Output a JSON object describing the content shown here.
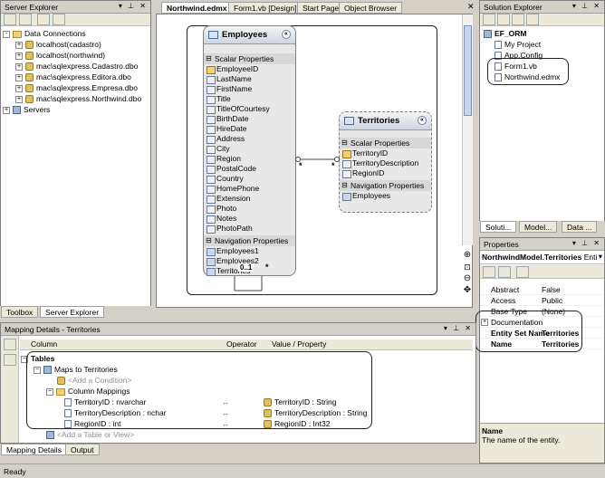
{
  "server_explorer": {
    "title": "Server Explorer",
    "tree": [
      {
        "label": "Data Connections",
        "level": 0,
        "type": "folder",
        "exp": "-"
      },
      {
        "label": "localhost(cadastro)",
        "level": 1,
        "type": "db",
        "exp": "+"
      },
      {
        "label": "localhost(northwind)",
        "level": 1,
        "type": "db",
        "exp": "+"
      },
      {
        "label": "mac\\sqlexpress.Cadastro.dbo",
        "level": 1,
        "type": "db",
        "exp": "+"
      },
      {
        "label": "mac\\sqlexpress.Editora.dbo",
        "level": 1,
        "type": "db",
        "exp": "+"
      },
      {
        "label": "mac\\sqlexpress.Empresa.dbo",
        "level": 1,
        "type": "db",
        "exp": "+"
      },
      {
        "label": "mac\\sqlexpress.Northwind.dbo",
        "level": 1,
        "type": "db",
        "exp": "+"
      },
      {
        "label": "Servers",
        "level": 0,
        "type": "server",
        "exp": "+"
      }
    ],
    "bottom_tabs": [
      "Toolbox",
      "Server Explorer"
    ]
  },
  "doc_tabs": [
    "Northwind.edmx",
    "Form1.vb [Design]",
    "Start Page",
    "Object Browser"
  ],
  "designer": {
    "employees": {
      "title": "Employees",
      "scalar_header": "Scalar Properties",
      "scalar": [
        "EmployeeID",
        "LastName",
        "FirstName",
        "Title",
        "TitleOfCourtesy",
        "BirthDate",
        "HireDate",
        "Address",
        "City",
        "Region",
        "PostalCode",
        "Country",
        "HomePhone",
        "Extension",
        "Photo",
        "Notes",
        "PhotoPath"
      ],
      "nav_header": "Navigation Properties",
      "nav": [
        "Employees1",
        "Employees2",
        "Territories"
      ]
    },
    "territories": {
      "title": "Territories",
      "scalar_header": "Scalar Properties",
      "scalar": [
        "TerritoryID",
        "TerritoryDescription",
        "RegionID"
      ],
      "nav_header": "Navigation Properties",
      "nav": [
        "Employees"
      ]
    },
    "self_assoc_label": "0..1",
    "assoc_mult_left": "*",
    "assoc_mult_right": "*",
    "self_assoc_mult": "*"
  },
  "solution_explorer": {
    "title": "Solution Explorer",
    "tree": [
      {
        "label": "EF_ORM",
        "level": 0,
        "bold": true
      },
      {
        "label": "My Project",
        "level": 1
      },
      {
        "label": "App.Config",
        "level": 1
      },
      {
        "label": "Form1.vb",
        "level": 1
      },
      {
        "label": "Northwind.edmx",
        "level": 1
      }
    ],
    "bottom_tabs": [
      "Soluti...",
      "Model...",
      "Data ..."
    ]
  },
  "properties": {
    "title": "Properties",
    "object": "NorthwindModel.Territories",
    "object_type": "Enti",
    "rows": [
      {
        "key": "Abstract",
        "value": "False",
        "bold": false
      },
      {
        "key": "Access",
        "value": "Public",
        "bold": false
      },
      {
        "key": "Base Type",
        "value": "(None)",
        "bold": false
      },
      {
        "key": "Documentation",
        "value": "",
        "bold": false,
        "expander": "+"
      },
      {
        "key": "Entity Set Name",
        "value": "Territories",
        "bold": true
      },
      {
        "key": "Name",
        "value": "Territories",
        "bold": true
      }
    ],
    "desc_title": "Name",
    "desc_text": "The name of the entity."
  },
  "mapping": {
    "title": "Mapping Details - Territories",
    "columns": [
      "Column",
      "Operator",
      "Value / Property"
    ],
    "tables_label": "Tables",
    "maps_to": "Maps to Territories",
    "add_condition": "<Add a Condition>",
    "column_mappings": "Column Mappings",
    "rows": [
      {
        "column": "TerritoryID : nvarchar",
        "op": "↔",
        "value": "TerritoryID : String"
      },
      {
        "column": "TerritoryDescription : nchar",
        "op": "↔",
        "value": "TerritoryDescription : String"
      },
      {
        "column": "RegionID : int",
        "op": "↔",
        "value": "RegionID : Int32"
      }
    ],
    "add_table": "<Add a Table or View>",
    "bottom_tabs": [
      "Mapping Details",
      "Output"
    ]
  },
  "status": "Ready"
}
